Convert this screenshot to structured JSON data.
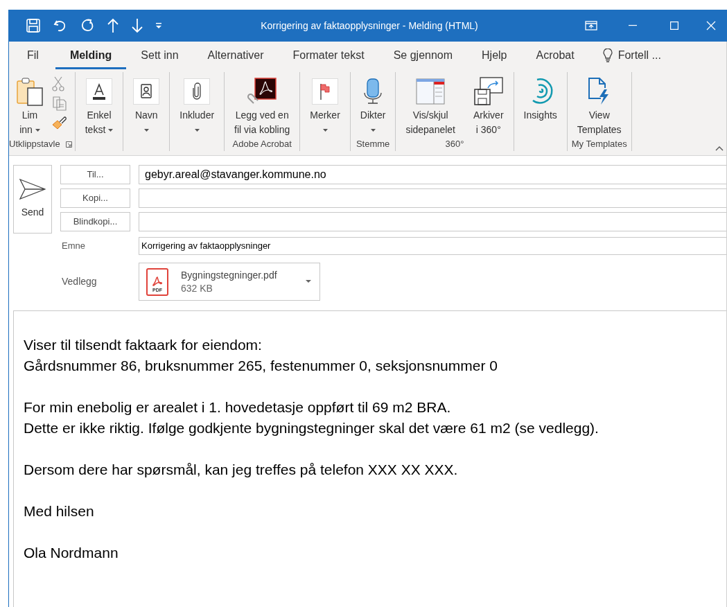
{
  "window": {
    "title": "Korrigering av faktaopplysninger  -  Melding (HTML)"
  },
  "tabs": [
    {
      "label": "Fil",
      "selected": false
    },
    {
      "label": "Melding",
      "selected": true
    },
    {
      "label": "Sett inn",
      "selected": false
    },
    {
      "label": "Alternativer",
      "selected": false
    },
    {
      "label": "Formater tekst",
      "selected": false
    },
    {
      "label": "Se gjennom",
      "selected": false
    },
    {
      "label": "Hjelp",
      "selected": false
    },
    {
      "label": "Acrobat",
      "selected": false
    }
  ],
  "tell_me": "Fortell ...",
  "ribbon_groups": [
    {
      "label": "Utklippstavle",
      "launcher": true,
      "buttons": [
        {
          "kind": "paste",
          "lines": [
            "Lim",
            "inn"
          ],
          "dropdown": true
        }
      ]
    },
    {
      "buttons": [
        {
          "kind": "text",
          "lines": [
            "Enkel",
            "tekst"
          ],
          "dropdown": true
        }
      ]
    },
    {
      "buttons": [
        {
          "kind": "contact",
          "lines": [
            "Navn"
          ],
          "dropdown": true
        }
      ]
    },
    {
      "buttons": [
        {
          "kind": "clip",
          "lines": [
            "Inkluder"
          ],
          "dropdown": true
        }
      ]
    },
    {
      "label": "Adobe Acrobat",
      "buttons": [
        {
          "kind": "acrobat",
          "lines": [
            "Legg ved en",
            "fil via kobling"
          ],
          "dropdown": false
        }
      ]
    },
    {
      "buttons": [
        {
          "kind": "flag",
          "lines": [
            "Merker"
          ],
          "dropdown": true
        }
      ]
    },
    {
      "label": "Stemme",
      "buttons": [
        {
          "kind": "mic",
          "lines": [
            "Dikter"
          ],
          "dropdown": true
        }
      ]
    },
    {
      "label": "360°",
      "buttons": [
        {
          "kind": "panel",
          "lines": [
            "Vis/skjul",
            "sidepanelet"
          ],
          "dropdown": false
        },
        {
          "kind": "archive",
          "lines": [
            "Arkiver",
            "i 360°"
          ],
          "dropdown": false
        }
      ]
    },
    {
      "buttons": [
        {
          "kind": "insights",
          "lines": [
            "Insights"
          ],
          "dropdown": false
        }
      ]
    },
    {
      "label": "My Templates",
      "buttons": [
        {
          "kind": "templates",
          "lines": [
            "View",
            "Templates"
          ],
          "dropdown": false
        }
      ]
    }
  ],
  "compose": {
    "send": "Send",
    "recipients": [
      {
        "button": "Til...",
        "value": "gebyr.areal@stavanger.kommune.no"
      },
      {
        "button": "Kopi..."
      },
      {
        "button": "Blindkopi..."
      }
    ],
    "subject_label": "Emne",
    "subject": "Korrigering av faktaopplysninger",
    "attachment_label": "Vedlegg",
    "attachment": {
      "icon_text": "PDF",
      "name": "Bygningstegninger.pdf",
      "size": "632 KB"
    }
  },
  "body": [
    [
      "Viser til tilsendt faktaark for eiendom:",
      "Gårdsnummer 86, bruksnummer 265, festenummer 0, seksjonsnummer 0"
    ],
    [
      "For min enebolig er arealet i 1. hovedetasje oppført til 69 m2 BRA.",
      "Dette er ikke riktig. Ifølge godkjente bygningstegninger skal det være 61 m2 (se vedlegg)."
    ],
    [
      "Dersom dere har spørsmål, kan jeg treffes på telefon XXX XX XXX."
    ],
    [
      "Med hilsen"
    ],
    [
      "Ola Nordmann"
    ]
  ]
}
